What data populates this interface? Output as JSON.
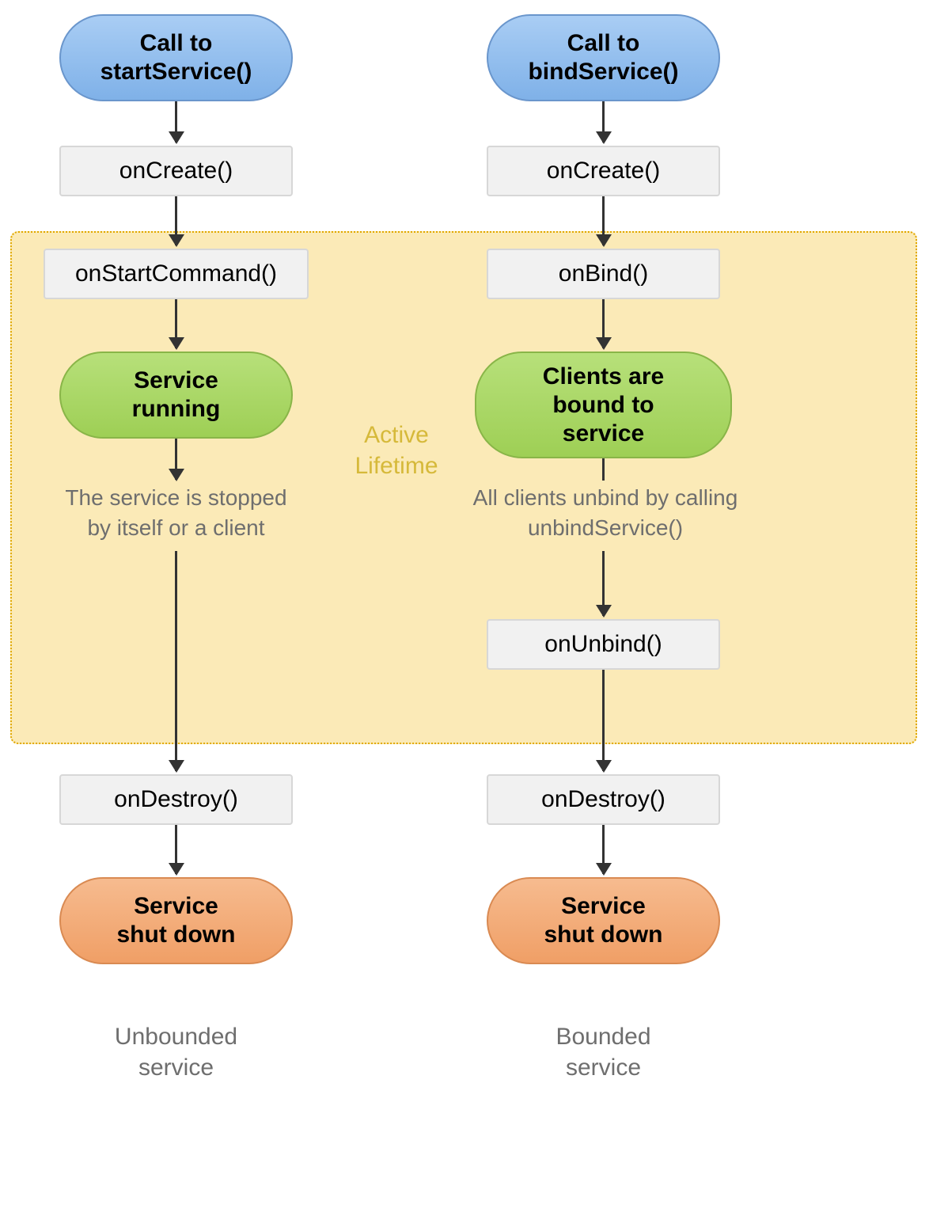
{
  "colors": {
    "blue_top": "#a9cdf4",
    "blue_bottom": "#7fb1e8",
    "green_top": "#b7e07a",
    "green_bottom": "#9ecf55",
    "orange_top": "#f6bb8f",
    "orange_bottom": "#f09f66",
    "grey": "#f1f1f1",
    "active_bg": "#fbeab7",
    "active_border": "#e0a800"
  },
  "active_lifetime_label": "Active\nLifetime",
  "left": {
    "start": "Call to\nstartService()",
    "onCreate": "onCreate()",
    "onStartCommand": "onStartCommand()",
    "running": "Service\nrunning",
    "note": "The service is stopped\nby itself or a client",
    "onDestroy": "onDestroy()",
    "shutdown": "Service\nshut down",
    "caption": "Unbounded\nservice"
  },
  "right": {
    "start": "Call to\nbindService()",
    "onCreate": "onCreate()",
    "onBind": "onBind()",
    "bound": "Clients are\nbound to\nservice",
    "note": "All clients unbind by calling\nunbindService()",
    "onUnbind": "onUnbind()",
    "onDestroy": "onDestroy()",
    "shutdown": "Service\nshut down",
    "caption": "Bounded\nservice"
  }
}
